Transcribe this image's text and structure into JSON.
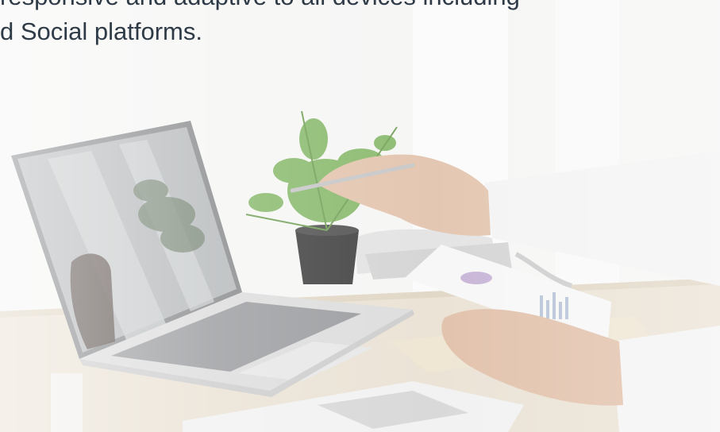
{
  "hero": {
    "line1": "responsive and adaptive to all devices including",
    "line2": "d Social platforms."
  },
  "photo": {
    "subject": "office desk photo",
    "colors": {
      "background": "#f5f5f4",
      "desk": "#e9dfcf",
      "laptop_body": "#dcdcdc",
      "plant": "#7fb06a",
      "text": "#2e3b47"
    }
  }
}
